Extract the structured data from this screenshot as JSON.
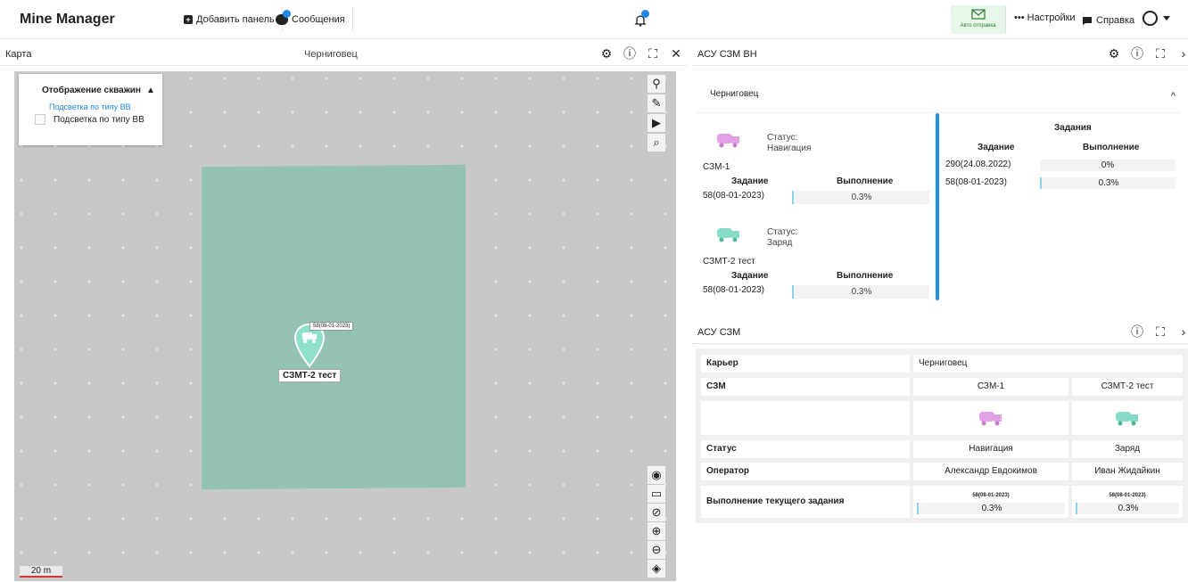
{
  "header": {
    "brand": "Mine Manager",
    "add_panel": "Добавить панель",
    "messages": "Сообщения",
    "auto_send": "Авто отправка",
    "settings": "Настройки",
    "help": "Справка"
  },
  "map_panel": {
    "title": "Карта",
    "center": "Черниговец",
    "legend_title": "Отображение скважин",
    "legend_link": "Подсветка по типу ВВ",
    "legend_checkbox": "Подсветка по типу ВВ",
    "scale": "20 m",
    "marker_tag": "58(08-01-2023)",
    "marker_label": "СЗМТ-2 тест"
  },
  "vn_panel": {
    "title": "АСУ СЗМ ВН",
    "section": "Черниговец",
    "status_label": "Статус:",
    "task_header": "Задание",
    "progress_header": "Выполнение",
    "vehicles": [
      {
        "name": "СЗМ-1",
        "status": "Навигация",
        "task": "58(08-01-2023)",
        "progress": "0.3%",
        "color": "#e2a0e6"
      },
      {
        "name": "СЗМТ-2 тест",
        "status": "Заряд",
        "task": "58(08-01-2023)",
        "progress": "0.3%",
        "color": "#86dcc6"
      }
    ],
    "tasks_title": "Задания",
    "tasks": [
      {
        "task": "290(24.08.2022)",
        "progress": "0%"
      },
      {
        "task": "58(08-01-2023)",
        "progress": "0.3%"
      }
    ]
  },
  "sz_panel": {
    "title": "АСУ СЗМ",
    "rows": {
      "quarry_label": "Карьер",
      "quarry_value": "Черниговец",
      "szm_label": "СЗМ",
      "szm1": "СЗМ-1",
      "szm2": "СЗМТ-2 тест",
      "status_label": "Статус",
      "status1": "Навигация",
      "status2": "Заряд",
      "operator_label": "Оператор",
      "operator1": "Александр Евдокимов",
      "operator2": "Иван Жидайкин",
      "exec_label": "Выполнение текущего задания",
      "exec_task1": "58(08-01-2023)",
      "exec_pct1": "0.3%",
      "exec_task2": "58(08-01-2023)",
      "exec_pct2": "0.3%"
    }
  }
}
